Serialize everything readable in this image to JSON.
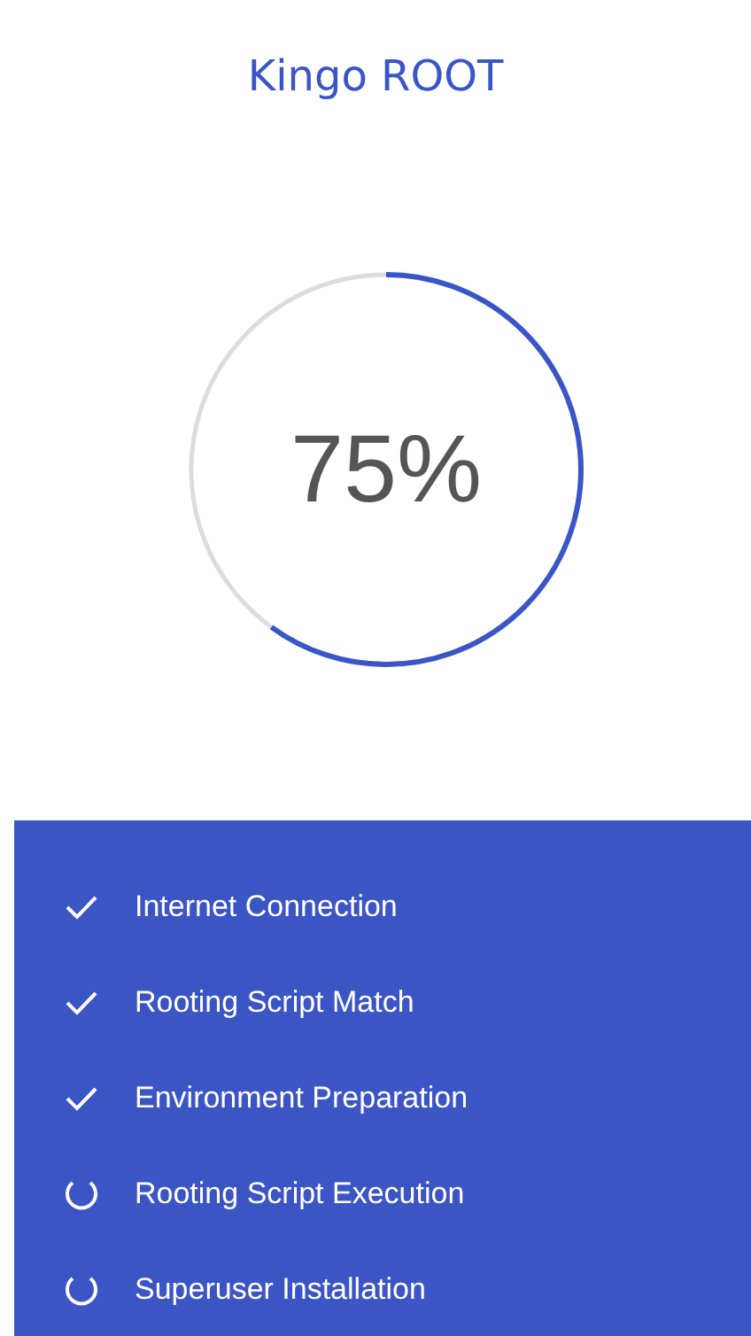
{
  "app_title": "Kingo ROOT",
  "progress": {
    "reading": "75%",
    "level": 0.6
  },
  "steps": [
    {
      "label": "Internet Connection",
      "done": true
    },
    {
      "label": "Rooting Script Match",
      "done": true
    },
    {
      "label": "Environment Preparation",
      "done": true
    },
    {
      "label": "Rooting Script Execution",
      "done": false
    },
    {
      "label": "Superuser Installation",
      "done": false
    }
  ]
}
